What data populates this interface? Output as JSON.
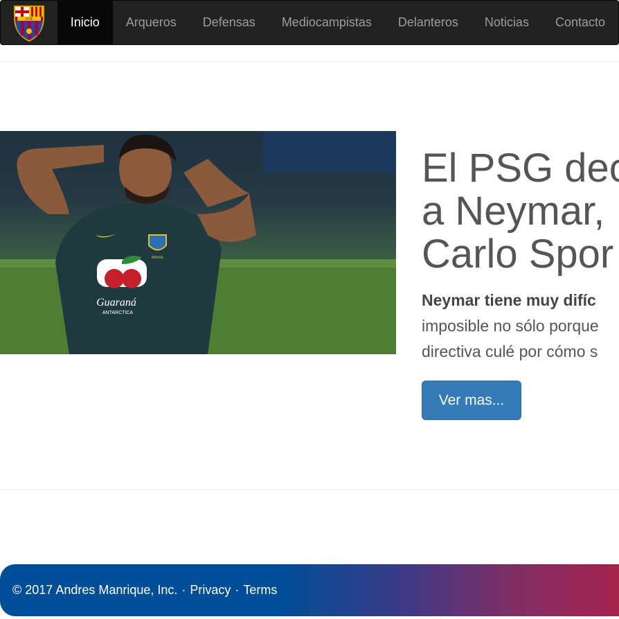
{
  "nav": {
    "logo_text": "FCB",
    "items": [
      {
        "label": "Inicio",
        "active": true
      },
      {
        "label": "Arqueros"
      },
      {
        "label": "Defensas"
      },
      {
        "label": "Mediocampistas"
      },
      {
        "label": "Delanteros"
      },
      {
        "label": "Noticias"
      },
      {
        "label": "Contacto"
      }
    ]
  },
  "feature": {
    "heading_line1": "El PSG dec",
    "heading_line2": "a Neymar,",
    "heading_line3": "Carlo Spor",
    "lead_bold": "Neymar tiene muy difíc",
    "lead_line2": "imposible no sólo porque",
    "lead_line3": "directiva culé por cómo s",
    "button_label": "Ver mas...",
    "photo_shirt_brand": "Guaraná",
    "photo_shirt_sub": "ANTARCTICA",
    "photo_crest_text": "BRASIL"
  },
  "footer": {
    "copyright": "© 2017 Andres Manrique, Inc.",
    "separator": "·",
    "privacy": "Privacy",
    "terms": "Terms"
  },
  "colors": {
    "navbar": "#222222",
    "primary_button": "#337ab7",
    "footer_blue": "#004d98",
    "footer_red": "#a5234d"
  }
}
